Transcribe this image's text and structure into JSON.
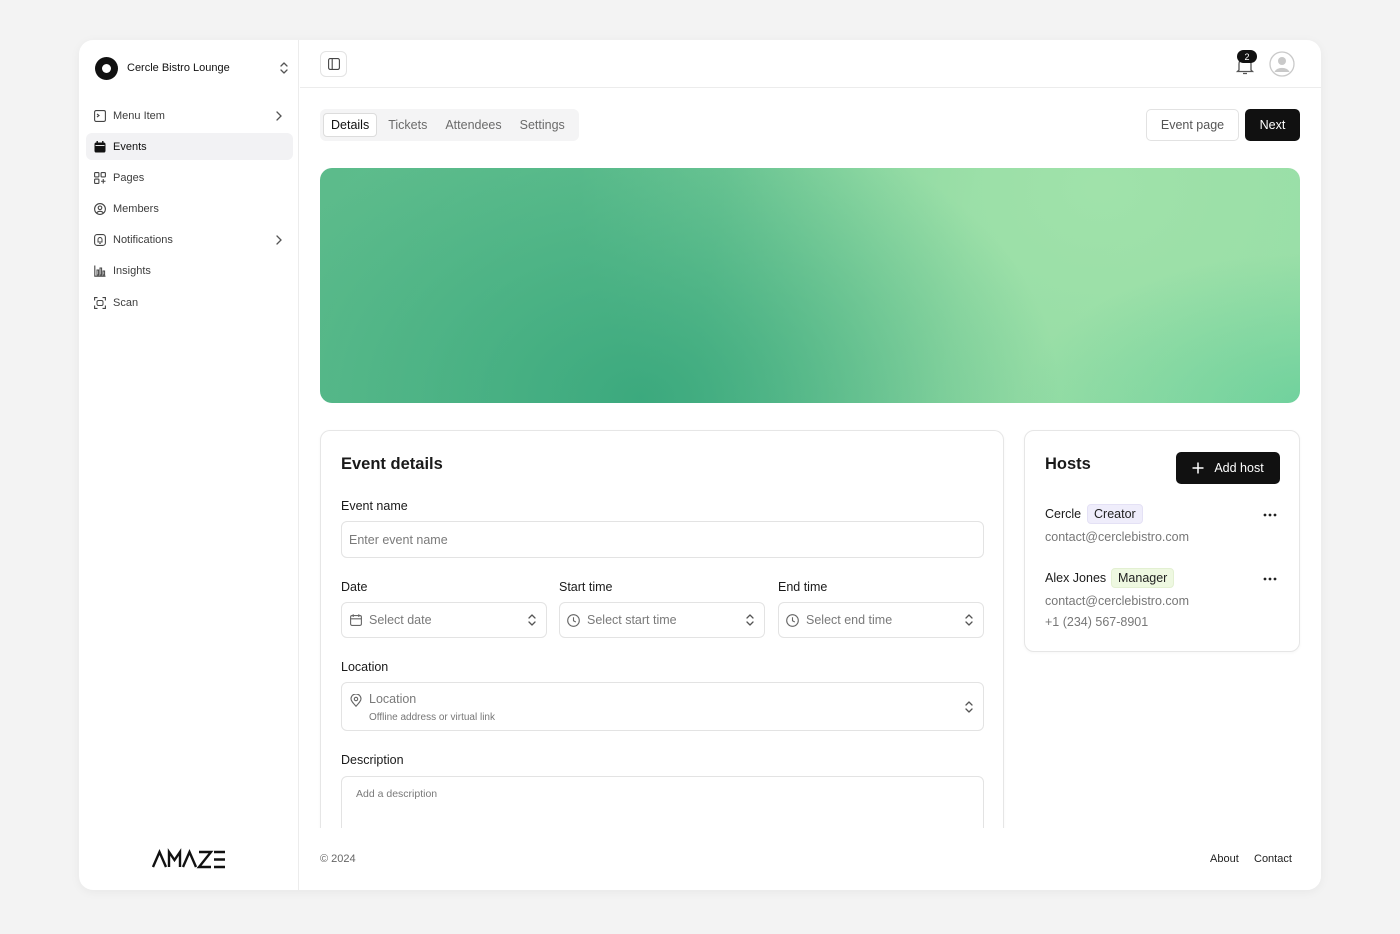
{
  "sidebar": {
    "org_name": "Cercle Bistro Lounge",
    "items": [
      {
        "label": "Menu Item",
        "icon": "menu-item-icon"
      },
      {
        "label": "Events",
        "icon": "calendar-icon"
      },
      {
        "label": "Pages",
        "icon": "pages-icon"
      },
      {
        "label": "Members",
        "icon": "members-icon"
      },
      {
        "label": "Notifications",
        "icon": "notifications-icon"
      },
      {
        "label": "Insights",
        "icon": "insights-icon"
      },
      {
        "label": "Scan",
        "icon": "scan-icon"
      }
    ],
    "active": "Events",
    "logo_text": "AMAZE"
  },
  "topbar": {
    "notification_count": "2"
  },
  "tabs": [
    "Details",
    "Tickets",
    "Attendees",
    "Settings"
  ],
  "active_tab": "Details",
  "actions": {
    "event_page": "Event page",
    "next": "Next"
  },
  "banner": {
    "colors": [
      "#3aa87d",
      "#92dba4",
      "#5cbb8b"
    ]
  },
  "event_details": {
    "title": "Event details",
    "event_name_label": "Event name",
    "event_name_placeholder": "Enter event name",
    "date_label": "Date",
    "date_placeholder": "Select date",
    "start_label": "Start time",
    "start_placeholder": "Select start time",
    "end_label": "End time",
    "end_placeholder": "Select end time",
    "location_label": "Location",
    "location_placeholder": "Location",
    "location_hint": "Offline address or virtual link",
    "description_label": "Description",
    "description_placeholder": "Add a description"
  },
  "hosts": {
    "title": "Hosts",
    "add_label": "Add host",
    "list": [
      {
        "name": "Cercle",
        "role": "Creator",
        "email": "contact@cerclebistro.com",
        "phone": ""
      },
      {
        "name": "Alex Jones",
        "role": "Manager",
        "email": "contact@cerclebistro.com",
        "phone": "+1 (234) 567-8901"
      }
    ]
  },
  "footer": {
    "copyright": "© 2024",
    "about": "About",
    "contact": "Contact"
  }
}
